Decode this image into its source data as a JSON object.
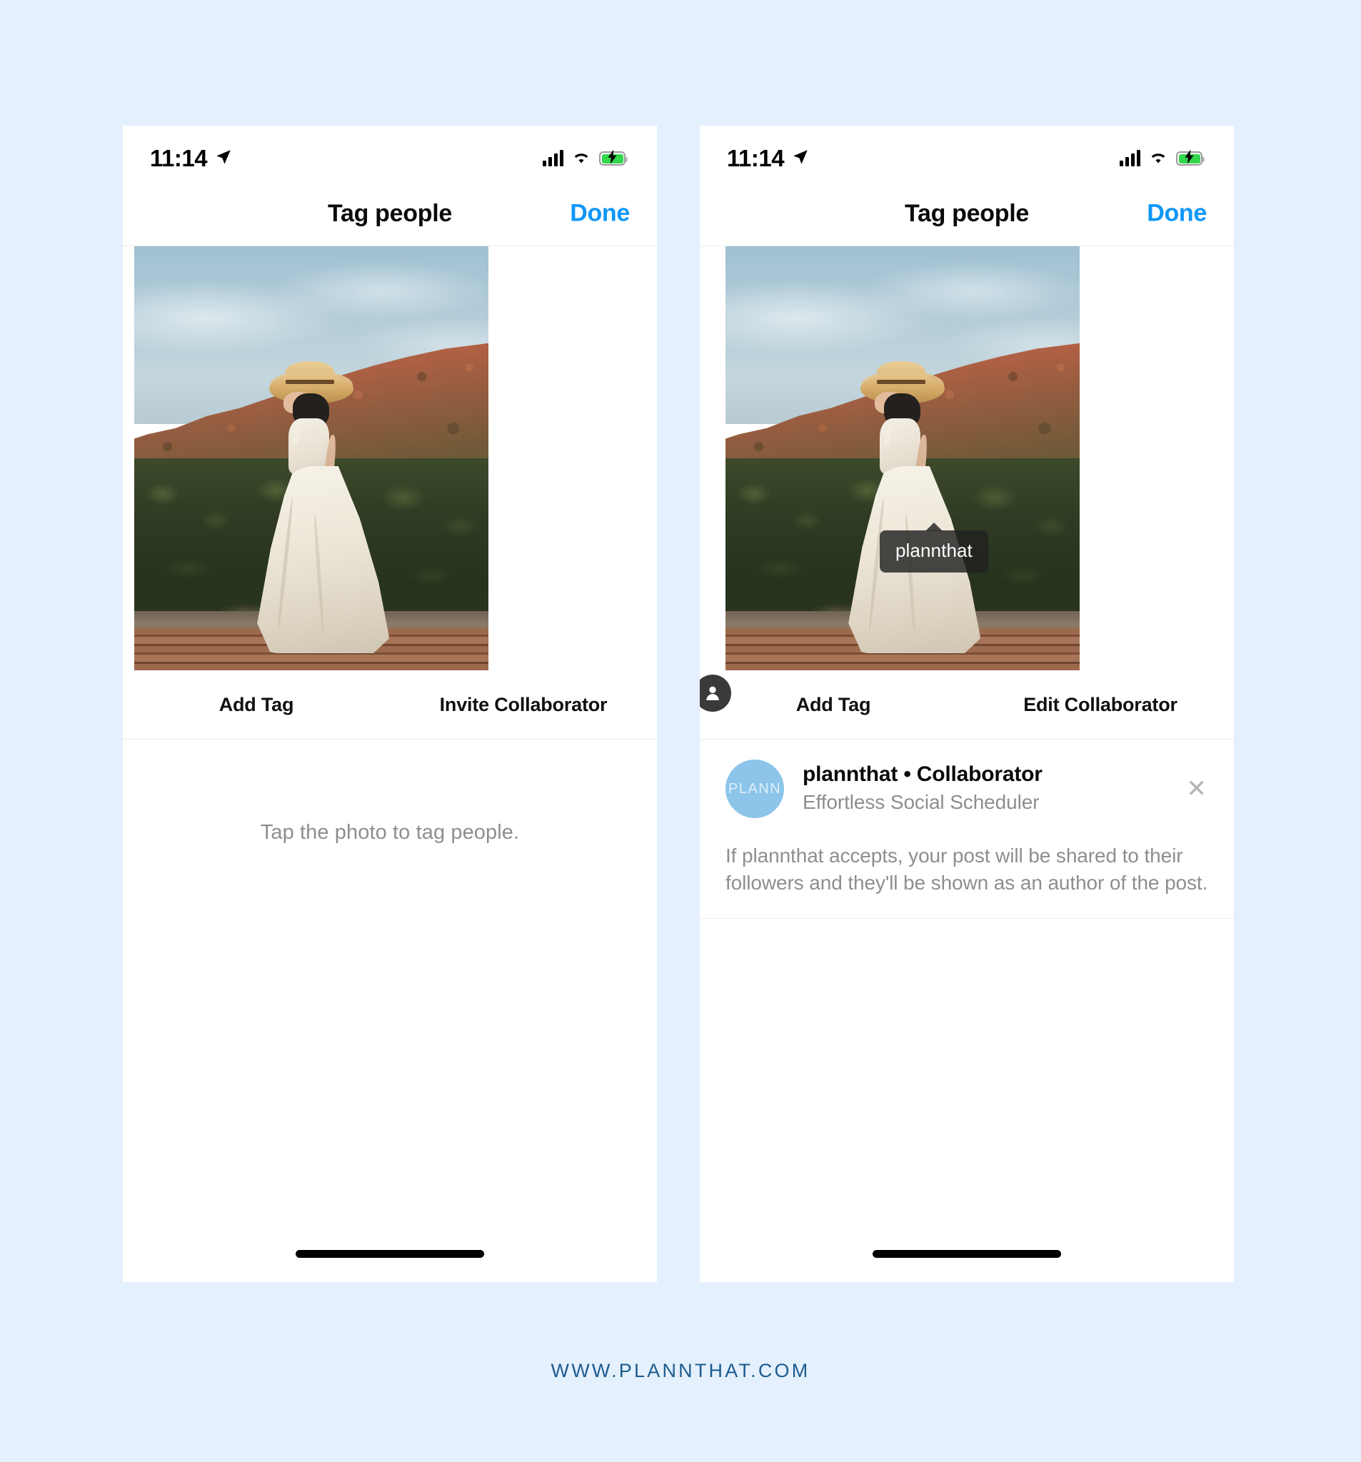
{
  "page": {
    "background_color": "#e4f0fd",
    "footer_link": "WWW.PLANNTHAT.COM",
    "footer_color": "#1c5b8f"
  },
  "status_bar": {
    "time": "11:14",
    "location_icon": "location-arrow-icon",
    "signal_icon": "cellular-signal-icon",
    "wifi_icon": "wifi-icon",
    "battery_icon": "battery-charging-icon",
    "battery_color": "#32d74b"
  },
  "screens": [
    {
      "id": "tag-people-empty",
      "nav": {
        "title": "Tag people",
        "done_label": "Done",
        "done_color": "#0f97f7"
      },
      "photo": {
        "alt": "Woman in cream dress and straw hat walking on a wooden deck in front of a rocky hillside",
        "tag_bubble": null,
        "tag_badge": null
      },
      "actions": [
        {
          "label": "Add Tag"
        },
        {
          "label": "Invite Collaborator"
        }
      ],
      "empty_state": {
        "text": "Tap the photo to tag people."
      },
      "collaborator": null
    },
    {
      "id": "tag-people-collaborator",
      "nav": {
        "title": "Tag people",
        "done_label": "Done",
        "done_color": "#0f97f7"
      },
      "photo": {
        "alt": "Woman in cream dress and straw hat walking on a wooden deck in front of a rocky hillside",
        "tag_bubble": "plannthat",
        "tag_badge": "person-icon"
      },
      "actions": [
        {
          "label": "Add Tag"
        },
        {
          "label": "Edit Collaborator"
        }
      ],
      "empty_state": null,
      "collaborator": {
        "avatar_initials": "PLANN",
        "avatar_color": "#8dc5ea",
        "name": "plannthat • Collaborator",
        "subtitle": "Effortless Social Scheduler",
        "close_label": "✕",
        "note": "If plannthat accepts, your post will be shared to their followers and they'll be shown as an author of the post."
      }
    }
  ]
}
